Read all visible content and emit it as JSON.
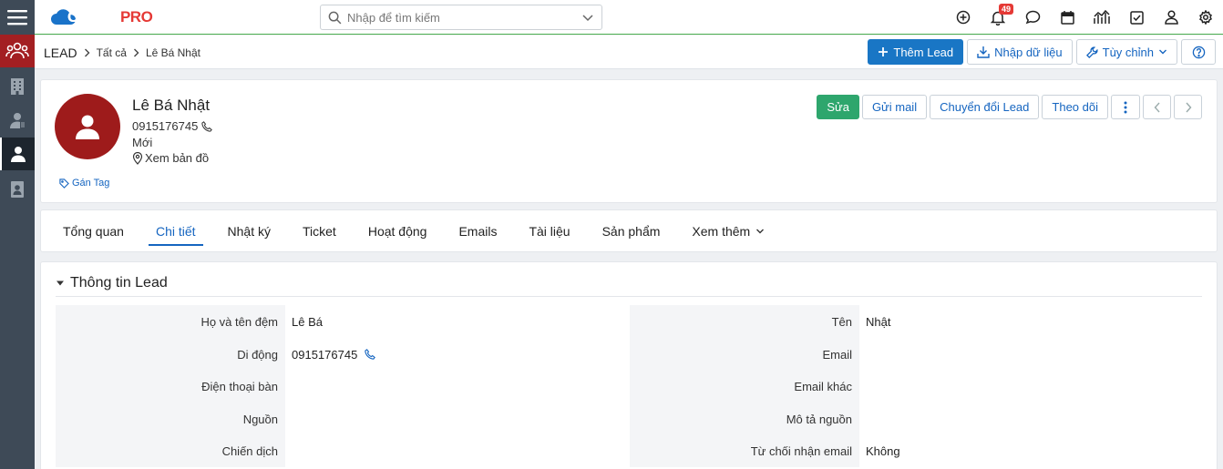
{
  "app": {
    "logo_main": "CLOUD",
    "logo_accent": "PRO",
    "search_placeholder": "Nhập để tìm kiếm",
    "notifications_count": "49"
  },
  "sidebar": {
    "items": [
      {
        "icon": "users-group-icon",
        "active_module": true
      },
      {
        "icon": "building-icon"
      },
      {
        "icon": "contacts-icon"
      },
      {
        "icon": "person-icon",
        "selected": true
      },
      {
        "icon": "contact-card-icon"
      }
    ]
  },
  "top_icons": [
    "add-circle-icon",
    "bell-icon",
    "chat-icon",
    "calendar-icon",
    "chart-icon",
    "checkbox-icon",
    "user-icon",
    "gear-icon"
  ],
  "breadcrumb": {
    "module": "LEAD",
    "all": "Tất cả",
    "current": "Lê Bá Nhật"
  },
  "header_actions": {
    "add_lead": "Thêm Lead",
    "import": "Nhập dữ liệu",
    "customize": "Tùy chỉnh"
  },
  "lead": {
    "name": "Lê Bá Nhật",
    "phone": "0915176745",
    "status": "Mới",
    "map_link": "Xem bản đồ",
    "tag_link": "Gán Tag"
  },
  "card_actions": {
    "edit": "Sửa",
    "send_mail": "Gửi mail",
    "convert": "Chuyển đổi Lead",
    "follow": "Theo dõi"
  },
  "tabs": [
    {
      "label": "Tổng quan"
    },
    {
      "label": "Chi tiết",
      "active": true
    },
    {
      "label": "Nhật ký"
    },
    {
      "label": "Ticket"
    },
    {
      "label": "Hoạt động"
    },
    {
      "label": "Emails"
    },
    {
      "label": "Tài liệu"
    },
    {
      "label": "Sản phẩm"
    },
    {
      "label": "Xem thêm"
    }
  ],
  "section": {
    "title": "Thông tin Lead",
    "left_fields": [
      {
        "label": "Họ và tên đệm",
        "value": "Lê Bá"
      },
      {
        "label": "Di động",
        "value": "0915176745"
      },
      {
        "label": "Điện thoại bàn",
        "value": ""
      },
      {
        "label": "Nguồn",
        "value": ""
      },
      {
        "label": "Chiến dịch",
        "value": ""
      }
    ],
    "right_fields": [
      {
        "label": "Tên",
        "value": "Nhật"
      },
      {
        "label": "Email",
        "value": ""
      },
      {
        "label": "Email khác",
        "value": ""
      },
      {
        "label": "Mô tả nguồn",
        "value": ""
      },
      {
        "label": "Từ chối nhận email",
        "value": "Không"
      }
    ]
  },
  "colors": {
    "sidebar_bg": "#3e4a57",
    "leads_active": "#a31f22",
    "primary": "#1976c5",
    "success": "#2ea66d",
    "avatar_bg": "#9e1b1b",
    "link": "#1565c0"
  }
}
